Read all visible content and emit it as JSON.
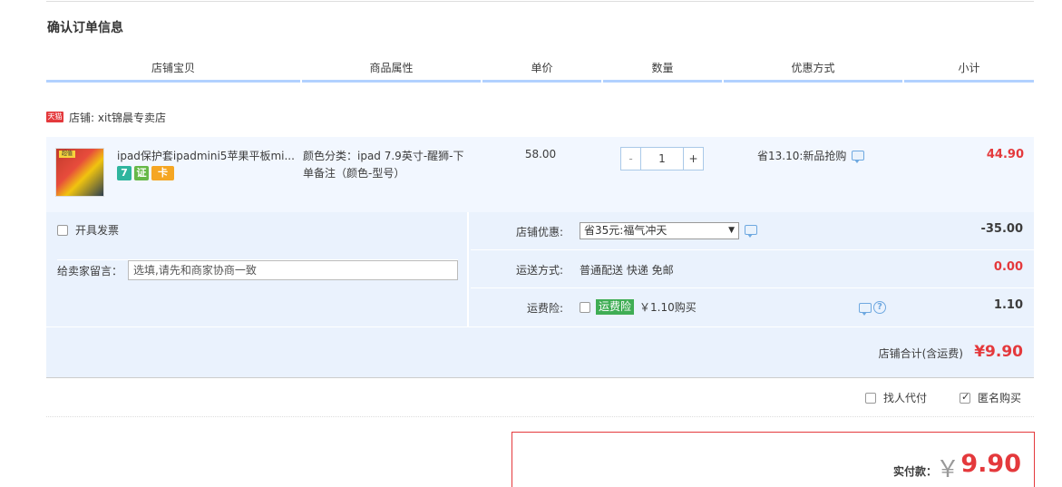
{
  "section_title": "确认订单信息",
  "columns": [
    "店铺宝贝",
    "商品属性",
    "单价",
    "数量",
    "优惠方式",
    "小计"
  ],
  "shop": {
    "badge": "天猫",
    "label": "店铺: xit锦晨专卖店"
  },
  "item": {
    "title": "ipad保护套ipadmini5苹果平板mi...",
    "attr_line1": "颜色分类：ipad 7.9英寸-醒狮-下",
    "attr_line2": "单备注（颜色-型号）",
    "price": "58.00",
    "qty_minus": "-",
    "qty": "1",
    "qty_plus": "+",
    "discount": "省13.10:新品抢购",
    "subtotal": "44.90",
    "badges": [
      "7",
      "证",
      "卡"
    ],
    "thumb_tag": "超值"
  },
  "invoice_label": "开具发票",
  "message": {
    "label": "给卖家留言：",
    "placeholder": "选填,请先和商家协商一致"
  },
  "shop_discount": {
    "label": "店铺优惠:",
    "selected": "省35元:福气冲天",
    "amount": "-35.00"
  },
  "shipping": {
    "label": "运送方式:",
    "value": "普通配送 快递 免邮",
    "amount": "0.00"
  },
  "insurance": {
    "label": "运费险:",
    "badge": "运费险",
    "price": "￥1.10购买",
    "amount": "1.10",
    "help": "?"
  },
  "total": {
    "label": "店铺合计(含运费)",
    "value": "¥9.90"
  },
  "proxy_pay": "找人代付",
  "anonymous": "匿名购买",
  "pay": {
    "label": "实付款：",
    "yen": "￥",
    "amount": "9.90"
  },
  "colors": {
    "accent_red": "#e4393c",
    "header_border": "#b2d1ff",
    "row_bg": "#eaf2fd"
  }
}
